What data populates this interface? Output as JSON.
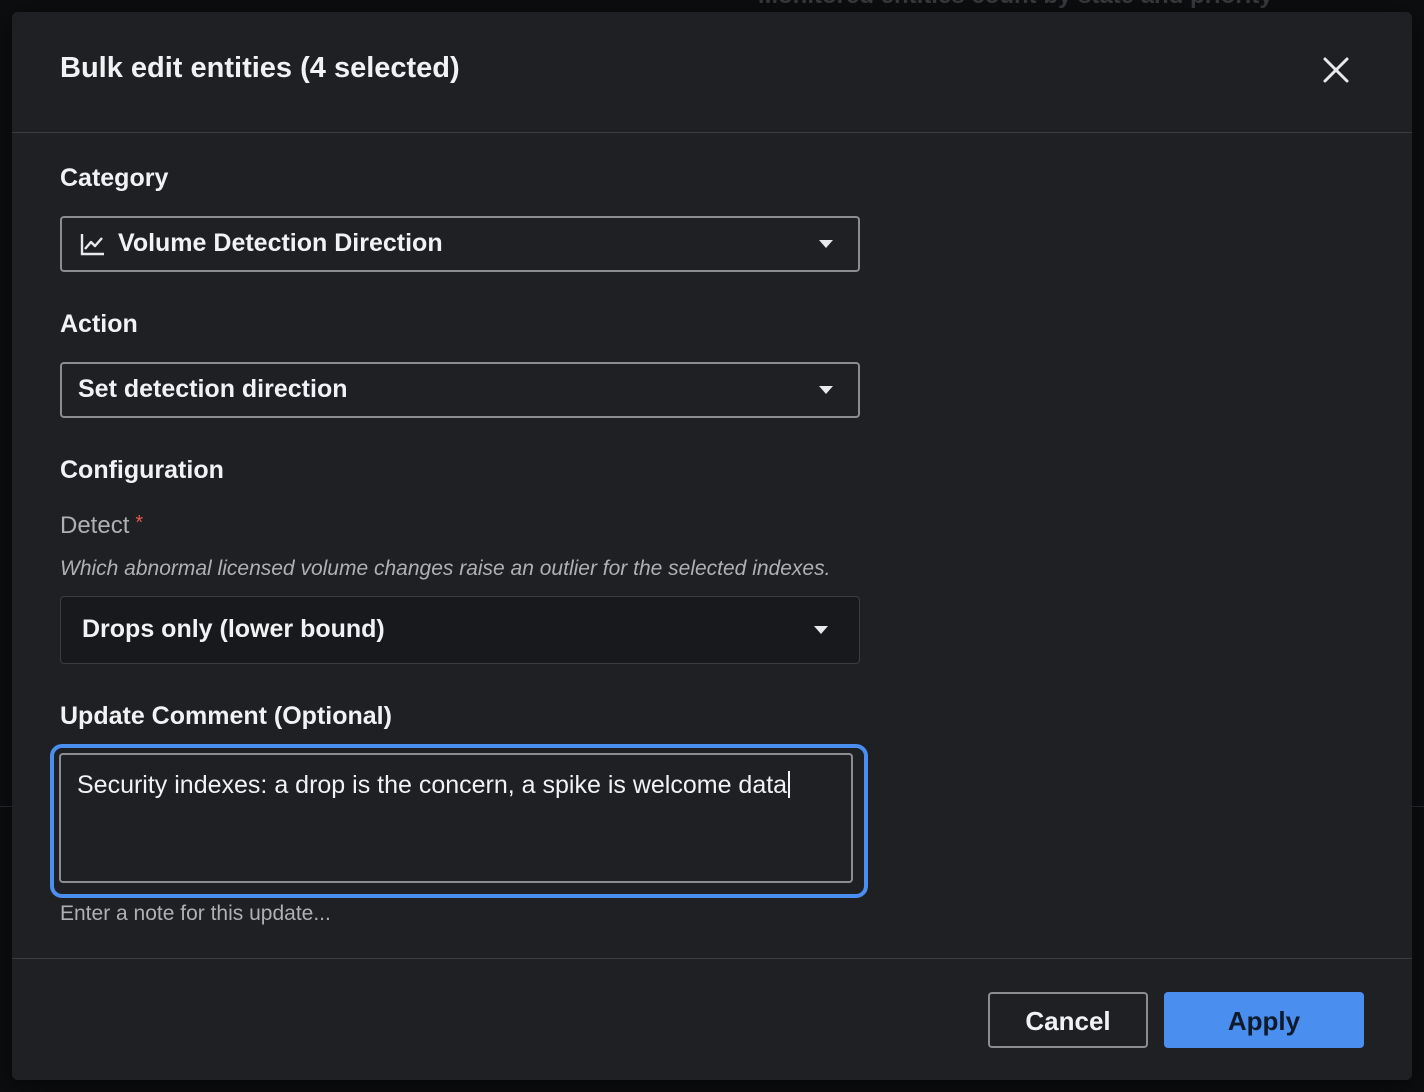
{
  "background": {
    "top_heading": "Monitored entities count by state and priority"
  },
  "modal": {
    "title": "Bulk edit entities (4 selected)"
  },
  "category": {
    "label": "Category",
    "selected": "Volume Detection Direction",
    "icon": "line-chart-icon"
  },
  "action": {
    "label": "Action",
    "selected": "Set detection direction"
  },
  "configuration": {
    "label": "Configuration",
    "detect_label": "Detect",
    "required_marker": "*",
    "help_text": "Which abnormal licensed volume changes raise an outlier for the selected indexes.",
    "detect_selected": "Drops only (lower bound)"
  },
  "comment": {
    "label": "Update Comment (Optional)",
    "value": "Security indexes: a drop is the concern, a spike is welcome data",
    "hint": "Enter a note for this update..."
  },
  "footer": {
    "cancel_label": "Cancel",
    "apply_label": "Apply"
  },
  "colors": {
    "modal_bg": "#1f2024",
    "accent": "#4a8ef0",
    "required": "#e05b4e"
  }
}
